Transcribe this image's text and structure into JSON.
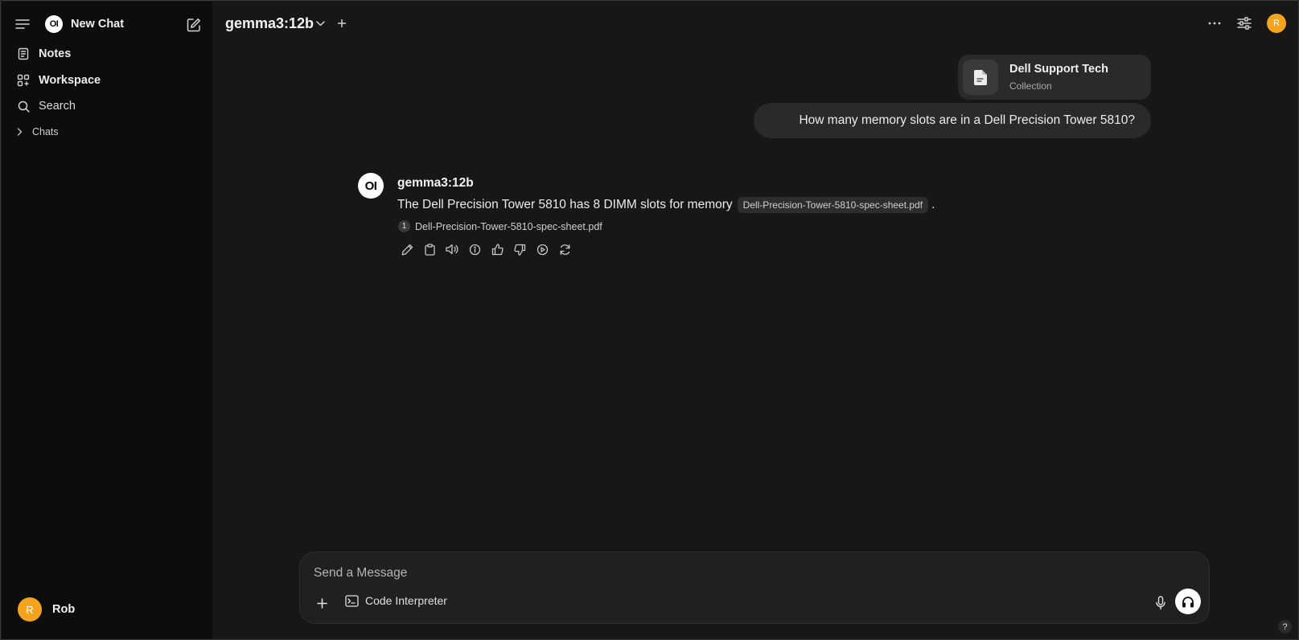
{
  "sidebar": {
    "brand_logo": "OI",
    "new_chat_label": "New Chat",
    "nav": [
      {
        "label": "Notes",
        "icon": "notes-icon"
      },
      {
        "label": "Workspace",
        "icon": "workspace-icon"
      },
      {
        "label": "Search",
        "icon": "search-icon"
      }
    ],
    "chats_label": "Chats",
    "user": {
      "initial": "R",
      "name": "Rob"
    }
  },
  "header": {
    "model": "gemma3:12b",
    "avatar_initial": "R"
  },
  "chat": {
    "collection": {
      "title": "Dell Support Tech",
      "subtitle": "Collection"
    },
    "user_message": "How many memory slots are in a Dell Precision Tower 5810?",
    "assistant": {
      "logo": "OI",
      "name": "gemma3:12b",
      "text": "The Dell Precision Tower 5810 has 8 DIMM slots for memory",
      "citation": "Dell-Precision-Tower-5810-spec-sheet.pdf",
      "trailing": ".",
      "source_number": "1",
      "source_name": "Dell-Precision-Tower-5810-spec-sheet.pdf"
    }
  },
  "composer": {
    "placeholder": "Send a Message",
    "code_interpreter_label": "Code Interpreter"
  },
  "help_label": "?",
  "colors": {
    "background": "#171717",
    "sidebar": "#0d0d0d",
    "avatar": "#f4a41c",
    "bubble": "#2a2a2a"
  }
}
